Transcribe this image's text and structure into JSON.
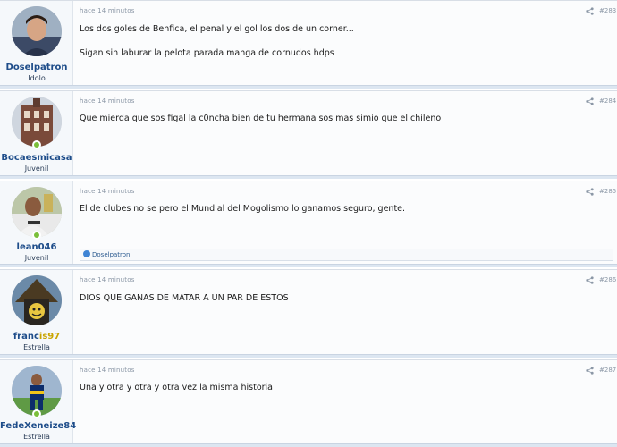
{
  "posts": [
    {
      "username": "Doselpatron",
      "user_title": "Idolo",
      "time": "hace 14 minutos",
      "number": "#283",
      "message": [
        "Los dos goles de Benfica, el penal y el gol los dos de un corner...",
        "Sigan sin laburar la pelota parada manga de cornudos hdps"
      ]
    },
    {
      "username": "Bocaesmicasa",
      "user_title": "Juvenil",
      "time": "hace 14 minutos",
      "number": "#284",
      "message": [
        "Que mierda que sos figal la c0ncha bien de tu hermana sos mas simio que el chileno"
      ]
    },
    {
      "username": "lean046",
      "user_title": "Juvenil",
      "time": "hace 14 minutos",
      "number": "#285",
      "message": [
        "El de clubes no se pero el Mundial del Mogolismo lo ganamos seguro, gente."
      ],
      "reaction_user": "Doselpatron"
    },
    {
      "username": "francis97",
      "username_prefix": "franc",
      "username_suffix": "is97",
      "user_title": "Estrella",
      "time": "hace 14 minutos",
      "number": "#286",
      "message": [
        "DIOS QUE GANAS DE MATAR A UN PAR DE ESTOS"
      ]
    },
    {
      "username": "FedeXeneize84",
      "user_title": "Estrella",
      "time": "hace 14 minutos",
      "number": "#287",
      "message": [
        "Una y otra y otra y otra vez la misma historia"
      ]
    }
  ],
  "colors": {
    "username_blue": "#1e4d8a",
    "username_gold": "#c9a400",
    "online": "#7bbf3a",
    "meta": "#8b97a6"
  },
  "icons": {
    "share": "share-icon",
    "online": "online-status-icon",
    "like": "like-icon"
  }
}
